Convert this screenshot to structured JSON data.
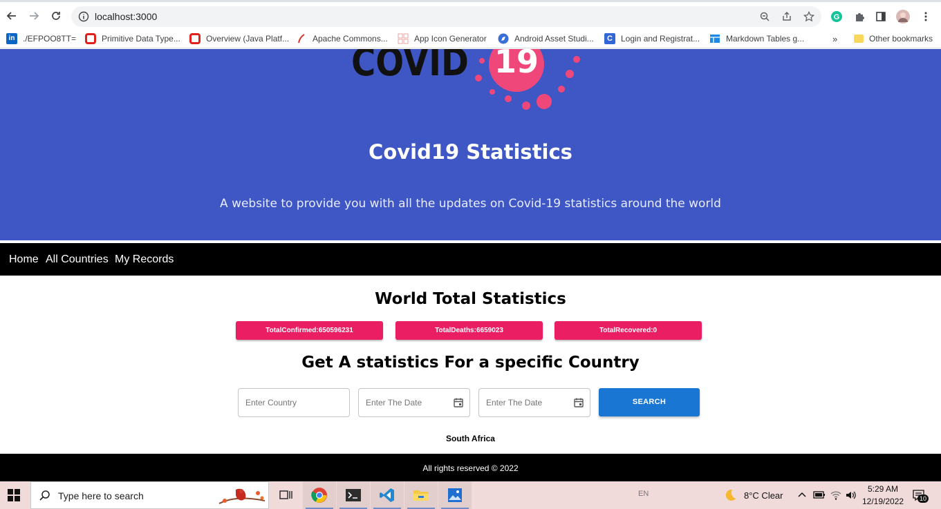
{
  "browser": {
    "url": "localhost:3000",
    "bookmarks": [
      {
        "label": "./EFPOO8TT=",
        "icon": "linkedin-icon"
      },
      {
        "label": "Primitive Data Type...",
        "icon": "oracle-icon"
      },
      {
        "label": "Overview (Java Platf...",
        "icon": "oracle-icon"
      },
      {
        "label": "Apache Commons...",
        "icon": "feather-icon"
      },
      {
        "label": "App Icon Generator",
        "icon": "grid-icon"
      },
      {
        "label": "Android Asset Studi...",
        "icon": "compass-icon"
      },
      {
        "label": "Login and Registrat...",
        "icon": "c-icon"
      },
      {
        "label": "Markdown Tables g...",
        "icon": "table-icon"
      }
    ],
    "more_label": "»",
    "other_bookmarks": "Other bookmarks"
  },
  "hero": {
    "logo_text": "COVID",
    "logo_number": "19",
    "title": "Covid19 Statistics",
    "subtitle": "A website to provide you with all the updates on Covid-19 statistics around the world"
  },
  "nav": {
    "items": [
      "Home",
      "All Countries",
      "My Records"
    ]
  },
  "world": {
    "heading": "World Total Statistics",
    "confirmed": "TotalConfirmed:650596231",
    "deaths": "TotalDeaths:6659023",
    "recovered": "TotalRecovered:0"
  },
  "search": {
    "heading": "Get A statistics For a specific Country",
    "country_placeholder": "Enter Country",
    "date1_placeholder": "Enter The Date",
    "date2_placeholder": "Enter The Date",
    "button": "SEARCH",
    "result_country": "South Africa"
  },
  "footer": {
    "text": "All rights reserved © 2022"
  },
  "taskbar": {
    "search_placeholder": "Type here to search",
    "lang": "EN",
    "weather": "8°C  Clear",
    "time": "5:29 AM",
    "date": "12/19/2022",
    "notifications": "10"
  },
  "colors": {
    "hero_bg": "#3f57c4",
    "stat_bg": "#e91e63",
    "search_bg": "#1976d2",
    "logo_pink": "#f0477a"
  }
}
